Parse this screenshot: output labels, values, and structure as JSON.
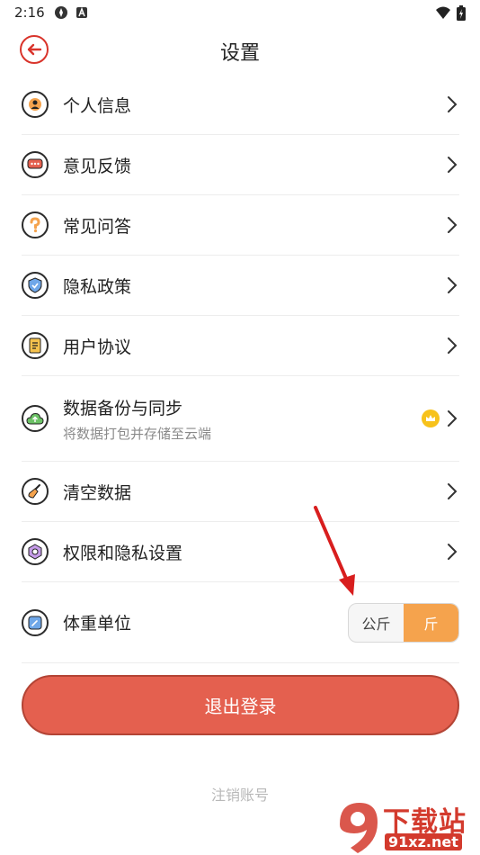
{
  "status": {
    "time": "2:16"
  },
  "header": {
    "title": "设置"
  },
  "items": [
    {
      "label": "个人信息",
      "icon": "user-icon"
    },
    {
      "label": "意见反馈",
      "icon": "feedback-icon"
    },
    {
      "label": "常见问答",
      "icon": "question-icon"
    },
    {
      "label": "隐私政策",
      "icon": "shield-icon"
    },
    {
      "label": "用户协议",
      "icon": "document-icon"
    },
    {
      "label": "数据备份与同步",
      "sub": "将数据打包并存储至云端",
      "icon": "cloud-icon",
      "badge": "crown-icon"
    },
    {
      "label": "清空数据",
      "icon": "broom-icon"
    },
    {
      "label": "权限和隐私设置",
      "icon": "privacy-settings-icon"
    }
  ],
  "weight_unit": {
    "label": "体重单位",
    "options": [
      "公斤",
      "斤"
    ],
    "selected": "斤",
    "icon": "scale-icon"
  },
  "logout_label": "退出登录",
  "cancel_account_label": "注销账号",
  "watermark": {
    "brand": "下载站",
    "url": "91xz.net"
  },
  "colors": {
    "accent": "#e4604f",
    "toggle_active": "#f5a34d",
    "annotation_arrow": "#d81e1e"
  }
}
